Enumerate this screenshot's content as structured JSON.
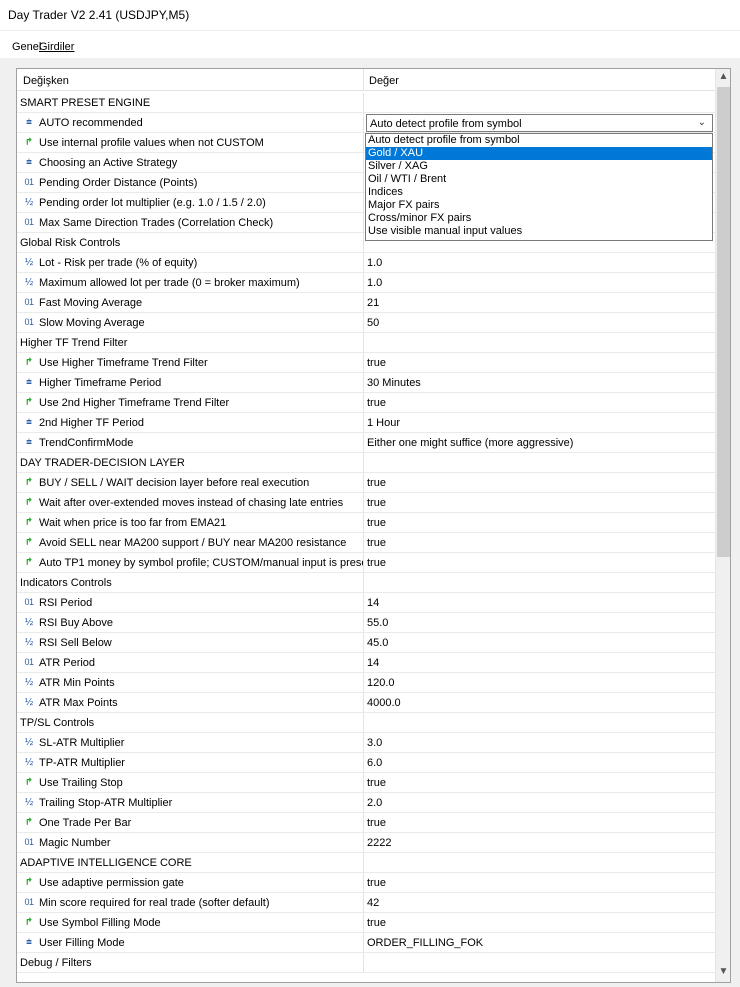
{
  "window": {
    "title": "Day Trader V2 2.41 (USDJPY,M5)"
  },
  "tabs": [
    {
      "label": "Genel"
    },
    {
      "label": "Girdiler"
    }
  ],
  "grid": {
    "col_variable": "Değişken",
    "col_value": "Değer"
  },
  "rows": [
    {
      "type": "section",
      "name": "SMART PRESET ENGINE",
      "value": ""
    },
    {
      "type": "enum",
      "icon": "⩧",
      "name": "AUTO recommended",
      "value": "Auto detect profile from symbol",
      "combo": true
    },
    {
      "type": "bool",
      "icon": "↱",
      "name": "Use internal profile values when not CUSTOM",
      "value": ""
    },
    {
      "type": "enum",
      "icon": "⩧",
      "name": "Choosing an Active Strategy",
      "value": ""
    },
    {
      "type": "int",
      "icon": "01",
      "name": "Pending Order Distance (Points)",
      "value": ""
    },
    {
      "type": "dbl",
      "icon": "½",
      "name": "Pending order lot multiplier (e.g. 1.0 / 1.5 / 2.0)",
      "value": ""
    },
    {
      "type": "int",
      "icon": "01",
      "name": "Max Same Direction Trades (Correlation Check)",
      "value": ""
    },
    {
      "type": "section",
      "name": "Global Risk Controls",
      "value": ""
    },
    {
      "type": "dbl",
      "icon": "½",
      "name": "Lot - Risk per trade (% of equity)",
      "value": "1.0"
    },
    {
      "type": "dbl",
      "icon": "½",
      "name": "Maximum allowed lot per trade (0 = broker maximum)",
      "value": "1.0"
    },
    {
      "type": "int",
      "icon": "01",
      "name": "Fast Moving Average",
      "value": "21"
    },
    {
      "type": "int",
      "icon": "01",
      "name": "Slow Moving Average",
      "value": "50"
    },
    {
      "type": "section",
      "name": "Higher TF Trend Filter",
      "value": ""
    },
    {
      "type": "bool",
      "icon": "↱",
      "name": "Use Higher Timeframe Trend Filter",
      "value": "true"
    },
    {
      "type": "enum",
      "icon": "⩧",
      "name": "Higher Timeframe Period",
      "value": "30 Minutes"
    },
    {
      "type": "bool",
      "icon": "↱",
      "name": "Use 2nd Higher Timeframe Trend Filter",
      "value": "true"
    },
    {
      "type": "enum",
      "icon": "⩧",
      "name": "2nd Higher TF Period",
      "value": "1 Hour"
    },
    {
      "type": "enum",
      "icon": "⩧",
      "name": "TrendConfirmMode",
      "value": "Either one might suffice (more aggressive)"
    },
    {
      "type": "section",
      "name": "DAY TRADER-DECISION LAYER",
      "value": ""
    },
    {
      "type": "bool",
      "icon": "↱",
      "name": "BUY / SELL / WAIT decision layer before real execution",
      "value": "true"
    },
    {
      "type": "bool",
      "icon": "↱",
      "name": "Wait after over-extended moves instead of chasing late entries",
      "value": "true"
    },
    {
      "type": "bool",
      "icon": "↱",
      "name": "Wait when price is too far from EMA21",
      "value": "true"
    },
    {
      "type": "bool",
      "icon": "↱",
      "name": "Avoid SELL near MA200 support / BUY near MA200 resistance",
      "value": "true"
    },
    {
      "type": "bool",
      "icon": "↱",
      "name": "Auto TP1 money by symbol profile; CUSTOM/manual input is preser",
      "value": "true"
    },
    {
      "type": "section",
      "name": "Indicators Controls",
      "value": ""
    },
    {
      "type": "int",
      "icon": "01",
      "name": "RSI Period",
      "value": "14"
    },
    {
      "type": "dbl",
      "icon": "½",
      "name": "RSI Buy Above",
      "value": "55.0"
    },
    {
      "type": "dbl",
      "icon": "½",
      "name": "RSI Sell Below",
      "value": "45.0"
    },
    {
      "type": "int",
      "icon": "01",
      "name": "ATR Period",
      "value": "14"
    },
    {
      "type": "dbl",
      "icon": "½",
      "name": "ATR Min Points",
      "value": "120.0"
    },
    {
      "type": "dbl",
      "icon": "½",
      "name": "ATR Max Points",
      "value": "4000.0"
    },
    {
      "type": "section",
      "name": "TP/SL Controls",
      "value": ""
    },
    {
      "type": "dbl",
      "icon": "½",
      "name": "SL-ATR Multiplier",
      "value": "3.0"
    },
    {
      "type": "dbl",
      "icon": "½",
      "name": "TP-ATR Multiplier",
      "value": "6.0"
    },
    {
      "type": "bool",
      "icon": "↱",
      "name": "Use Trailing Stop",
      "value": "true"
    },
    {
      "type": "dbl",
      "icon": "½",
      "name": "Trailing Stop-ATR Multiplier",
      "value": "2.0"
    },
    {
      "type": "bool",
      "icon": "↱",
      "name": "One Trade Per Bar",
      "value": "true"
    },
    {
      "type": "int",
      "icon": "01",
      "name": "Magic Number",
      "value": "2222"
    },
    {
      "type": "section",
      "name": "ADAPTIVE INTELLIGENCE CORE",
      "value": ""
    },
    {
      "type": "bool",
      "icon": "↱",
      "name": "Use adaptive permission gate",
      "value": "true"
    },
    {
      "type": "int",
      "icon": "01",
      "name": "Min score required for real trade (softer default)",
      "value": "42"
    },
    {
      "type": "bool",
      "icon": "↱",
      "name": "Use Symbol Filling Mode",
      "value": "true"
    },
    {
      "type": "enum",
      "icon": "⩧",
      "name": "User Filling Mode",
      "value": "ORDER_FILLING_FOK"
    },
    {
      "type": "section",
      "name": "Debug / Filters",
      "value": ""
    }
  ],
  "dropdown": {
    "selected_index": 1,
    "options": [
      "Auto detect profile from symbol",
      "Gold / XAU",
      "Silver / XAG",
      "Oil / WTI / Brent",
      "Indices",
      "Major FX pairs",
      "Cross/minor FX pairs",
      "Use visible manual input values"
    ]
  },
  "scrollbar": {
    "position_fraction": 0.0,
    "visible_fraction": 0.52
  },
  "icons": {
    "bool": "checkbox-arrow-icon",
    "enum": "list-icon",
    "int": "integer-icon",
    "dbl": "fraction-icon"
  }
}
